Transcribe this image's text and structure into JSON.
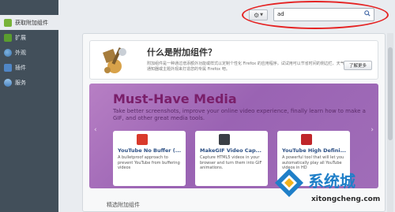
{
  "sidebar": {
    "items": [
      {
        "label": "获取附加组件",
        "icon": "puzzle-icon",
        "active": true
      },
      {
        "label": "扩展",
        "icon": "extension-icon"
      },
      {
        "label": "外观",
        "icon": "theme-icon"
      },
      {
        "label": "插件",
        "icon": "plugin-icon"
      },
      {
        "label": "服务",
        "icon": "service-icon"
      }
    ]
  },
  "toolbar": {
    "gear_label": "⚙",
    "search_value": "ad",
    "search_icon": "🔍"
  },
  "intro": {
    "title": "什么是附加组件？",
    "text": "附加组件是一种通过增添额外功能或样式以定制个性化 Firefox 的应用程序。试试用可以节省时间的侧边栏、天气通知器或主题外观来打造您的专属 Firefox 吧。",
    "learn_more": "了解更多"
  },
  "featured": {
    "title": "Must-Have Media",
    "text": "Take better screenshots, improve your online video experience, finally learn how to make a GIF, and other great media tools.",
    "prev": "‹",
    "next": "›",
    "cards": [
      {
        "title": "YouTube No Buffer (...",
        "desc": "A bulletproof approach to prevent YouTube from buffering videos",
        "icon": "youtube-no-buffer-icon",
        "color": "#d93a2b"
      },
      {
        "title": "MakeGIF Video Cap...",
        "desc": "Capture HTML5 videos in your browser and turn them into GIF animations.",
        "icon": "makegif-icon",
        "color": "#3a3f45"
      },
      {
        "title": "YouTube High Defini...",
        "desc": "A powerful tool that will let you automatically play all YouTube videos in HD",
        "icon": "youtube-hd-icon",
        "color": "#c0262a"
      }
    ]
  },
  "section": {
    "title": "精选附加组件"
  },
  "watermark": {
    "cn": "系统城",
    "en": "xitongcheng.com"
  }
}
